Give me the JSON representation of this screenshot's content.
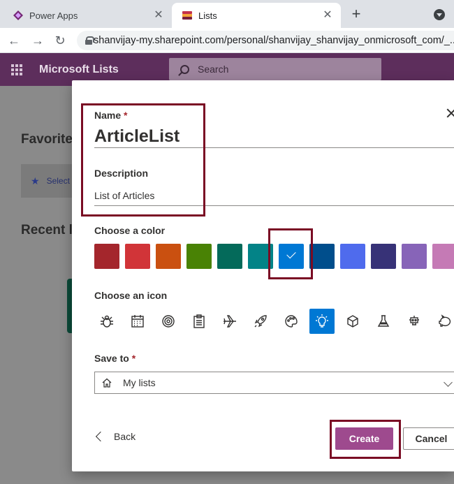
{
  "browser": {
    "tabs": [
      {
        "title": "Power Apps",
        "close": "✕"
      },
      {
        "title": "Lists",
        "close": "✕"
      }
    ],
    "new_tab": "+",
    "url": "shanvijay-my.sharepoint.com/personal/shanvijay_shanvijay_onmicrosoft_com/_..."
  },
  "app": {
    "name": "Microsoft Lists",
    "search_placeholder": "Search"
  },
  "background": {
    "favorites_heading": "Favorite",
    "favorites_card": "Select",
    "recent_heading": "Recent l"
  },
  "dialog": {
    "name_label": "Name",
    "required_mark": "*",
    "name_value": "ArticleList",
    "description_label": "Description",
    "description_value": "List of Articles",
    "color_label": "Choose a color",
    "colors": [
      "#a4262c",
      "#d13438",
      "#ca5010",
      "#498205",
      "#046a5a",
      "#038387",
      "#0078d4",
      "#004e8c",
      "#4f6bed",
      "#373277",
      "#8764b8",
      "#c57ab5"
    ],
    "selected_color_index": 6,
    "icon_label": "Choose an icon",
    "icons": [
      "bug-icon",
      "calendar-icon",
      "target-icon",
      "clipboard-icon",
      "airplane-icon",
      "rocket-icon",
      "palette-icon",
      "lightbulb-icon",
      "cube-icon",
      "beaker-icon",
      "robot-icon",
      "piggy-bank-icon"
    ],
    "selected_icon_index": 7,
    "save_to_label": "Save to",
    "save_to_value": "My lists",
    "back_label": "Back",
    "create_label": "Create",
    "cancel_label": "Cancel"
  },
  "colors": {
    "header_bg": "#5d2e5c",
    "create_button": "#9e4a8e",
    "highlight_border": "#7a0c24",
    "accent": "#0078d4"
  }
}
